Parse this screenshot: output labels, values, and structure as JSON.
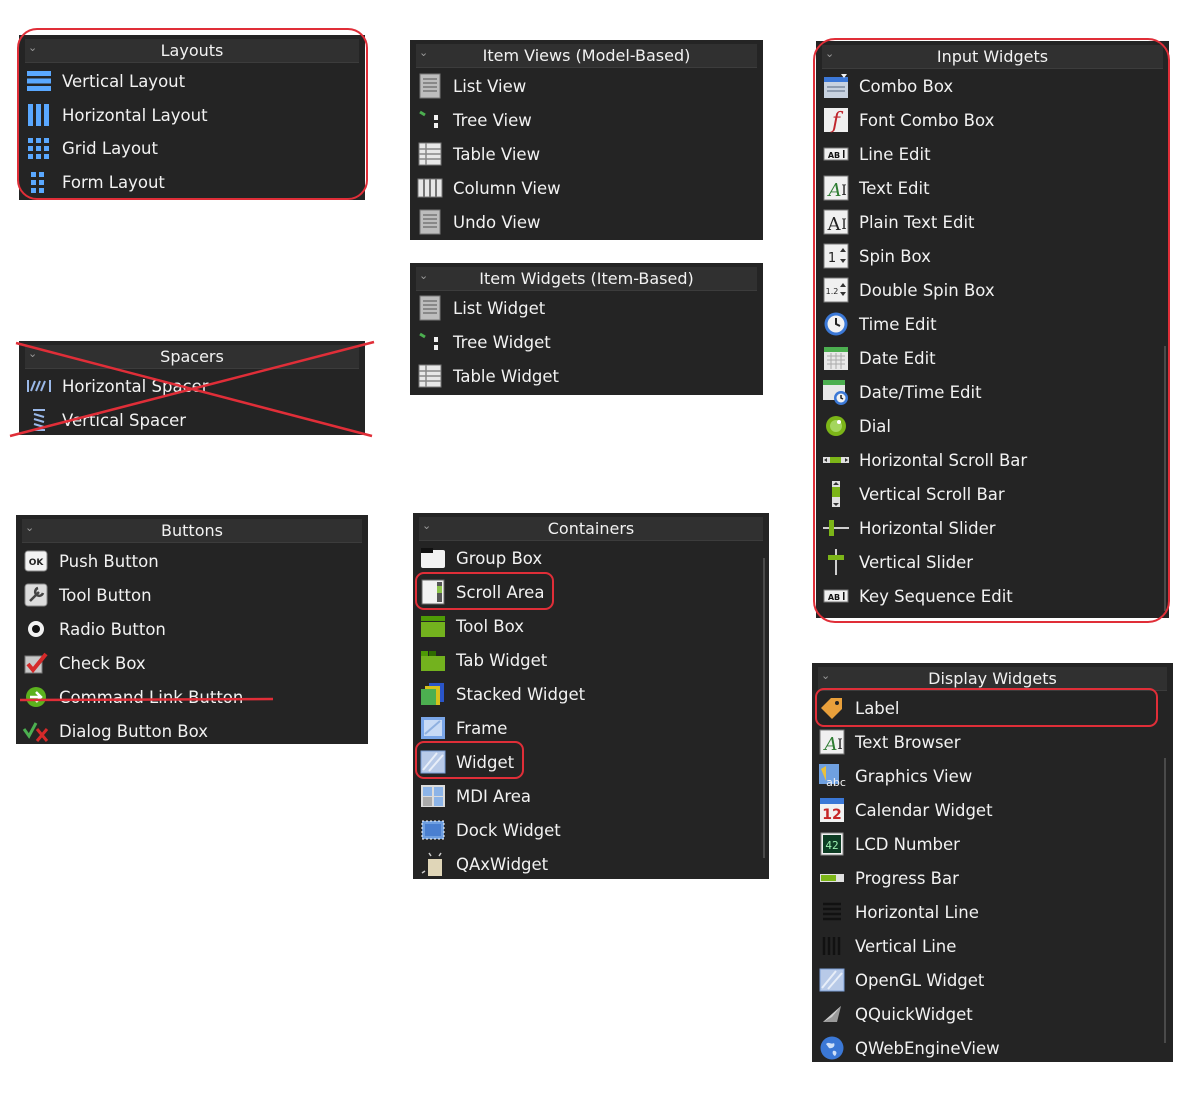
{
  "layouts": {
    "title": "Layouts",
    "items": [
      {
        "label": "Vertical Layout",
        "icon": "vertical-layout-icon"
      },
      {
        "label": "Horizontal Layout",
        "icon": "horizontal-layout-icon"
      },
      {
        "label": "Grid Layout",
        "icon": "grid-layout-icon"
      },
      {
        "label": "Form Layout",
        "icon": "form-layout-icon"
      }
    ]
  },
  "spacers": {
    "title": "Spacers",
    "items": [
      {
        "label": "Horizontal Spacer",
        "icon": "horizontal-spacer-icon"
      },
      {
        "label": "Vertical Spacer",
        "icon": "vertical-spacer-icon"
      }
    ]
  },
  "buttons": {
    "title": "Buttons",
    "items": [
      {
        "label": "Push Button",
        "icon": "push-button-icon"
      },
      {
        "label": "Tool Button",
        "icon": "tool-button-icon"
      },
      {
        "label": "Radio Button",
        "icon": "radio-button-icon"
      },
      {
        "label": "Check Box",
        "icon": "check-box-icon"
      },
      {
        "label": "Command Link Button",
        "icon": "command-link-icon"
      },
      {
        "label": "Dialog Button Box",
        "icon": "dialog-button-box-icon"
      }
    ]
  },
  "item_views": {
    "title": "Item Views (Model-Based)",
    "items": [
      {
        "label": "List View",
        "icon": "list-view-icon"
      },
      {
        "label": "Tree View",
        "icon": "tree-view-icon"
      },
      {
        "label": "Table View",
        "icon": "table-view-icon"
      },
      {
        "label": "Column View",
        "icon": "column-view-icon"
      },
      {
        "label": "Undo View",
        "icon": "undo-view-icon"
      }
    ]
  },
  "item_widgets": {
    "title": "Item Widgets (Item-Based)",
    "items": [
      {
        "label": "List Widget",
        "icon": "list-widget-icon"
      },
      {
        "label": "Tree Widget",
        "icon": "tree-widget-icon"
      },
      {
        "label": "Table Widget",
        "icon": "table-widget-icon"
      }
    ]
  },
  "containers": {
    "title": "Containers",
    "items": [
      {
        "label": "Group Box",
        "icon": "group-box-icon"
      },
      {
        "label": "Scroll Area",
        "icon": "scroll-area-icon"
      },
      {
        "label": "Tool Box",
        "icon": "tool-box-icon"
      },
      {
        "label": "Tab Widget",
        "icon": "tab-widget-icon"
      },
      {
        "label": "Stacked Widget",
        "icon": "stacked-widget-icon"
      },
      {
        "label": "Frame",
        "icon": "frame-icon"
      },
      {
        "label": "Widget",
        "icon": "widget-icon"
      },
      {
        "label": "MDI Area",
        "icon": "mdi-area-icon"
      },
      {
        "label": "Dock Widget",
        "icon": "dock-widget-icon"
      },
      {
        "label": "QAxWidget",
        "icon": "qaxwidget-icon"
      }
    ]
  },
  "input_widgets": {
    "title": "Input Widgets",
    "items": [
      {
        "label": "Combo Box",
        "icon": "combo-box-icon"
      },
      {
        "label": "Font Combo Box",
        "icon": "font-combo-box-icon"
      },
      {
        "label": "Line Edit",
        "icon": "line-edit-icon"
      },
      {
        "label": "Text Edit",
        "icon": "text-edit-icon"
      },
      {
        "label": "Plain Text Edit",
        "icon": "plain-text-edit-icon"
      },
      {
        "label": "Spin Box",
        "icon": "spin-box-icon"
      },
      {
        "label": "Double Spin Box",
        "icon": "double-spin-box-icon"
      },
      {
        "label": "Time Edit",
        "icon": "time-edit-icon"
      },
      {
        "label": "Date Edit",
        "icon": "date-edit-icon"
      },
      {
        "label": "Date/Time Edit",
        "icon": "date-time-edit-icon"
      },
      {
        "label": "Dial",
        "icon": "dial-icon"
      },
      {
        "label": "Horizontal Scroll Bar",
        "icon": "horizontal-scroll-bar-icon"
      },
      {
        "label": "Vertical Scroll Bar",
        "icon": "vertical-scroll-bar-icon"
      },
      {
        "label": "Horizontal Slider",
        "icon": "horizontal-slider-icon"
      },
      {
        "label": "Vertical Slider",
        "icon": "vertical-slider-icon"
      },
      {
        "label": "Key Sequence Edit",
        "icon": "key-sequence-edit-icon"
      }
    ]
  },
  "display_widgets": {
    "title": "Display Widgets",
    "items": [
      {
        "label": "Label",
        "icon": "label-icon"
      },
      {
        "label": "Text Browser",
        "icon": "text-browser-icon"
      },
      {
        "label": "Graphics View",
        "icon": "graphics-view-icon"
      },
      {
        "label": "Calendar Widget",
        "icon": "calendar-widget-icon"
      },
      {
        "label": "LCD Number",
        "icon": "lcd-number-icon"
      },
      {
        "label": "Progress Bar",
        "icon": "progress-bar-icon"
      },
      {
        "label": "Horizontal Line",
        "icon": "horizontal-line-icon"
      },
      {
        "label": "Vertical Line",
        "icon": "vertical-line-icon"
      },
      {
        "label": "OpenGL Widget",
        "icon": "opengl-widget-icon"
      },
      {
        "label": "QQuickWidget",
        "icon": "qquickwidget-icon"
      },
      {
        "label": "QWebEngineView",
        "icon": "qwebengineview-icon"
      }
    ]
  },
  "annotation_colors": {
    "highlight": "#e02e38"
  }
}
